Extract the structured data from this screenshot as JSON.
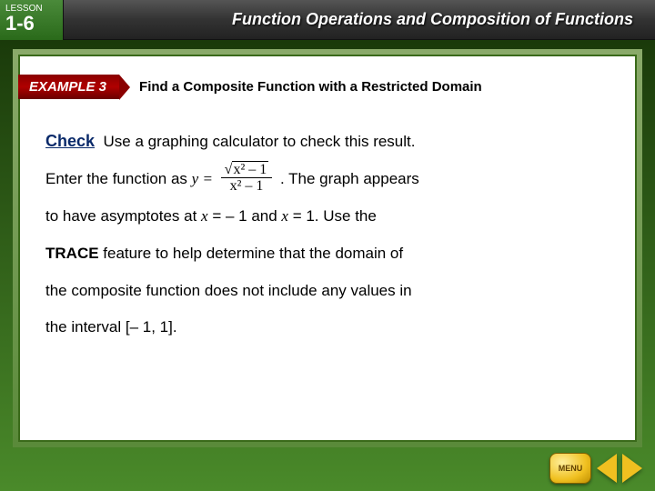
{
  "header": {
    "lesson_label": "LESSON",
    "lesson_number": "1-6",
    "title": "Function Operations and Composition of Functions"
  },
  "example": {
    "tab": "EXAMPLE 3",
    "title": "Find a Composite Function with a Restricted Domain"
  },
  "body": {
    "check_word": "Check",
    "line1_rest": "Use a graphing calculator to check this result.",
    "line2_a": "Enter the function as ",
    "eq_lhs": "y =",
    "eq_num_rad": "x² – 1",
    "eq_den": "x² – 1",
    "line2_b": ". The graph appears",
    "line3_a": "to have asymptotes at ",
    "var_x1": "x",
    "eq1": " = – 1 and ",
    "var_x2": "x",
    "eq2": " = 1. Use the",
    "line4_a": "TRACE",
    "line4_b": " feature to help determine that the domain of",
    "line5": "the composite function does not include any values in",
    "line6": "the interval [– 1, 1]."
  },
  "nav": {
    "menu": "MENU"
  }
}
